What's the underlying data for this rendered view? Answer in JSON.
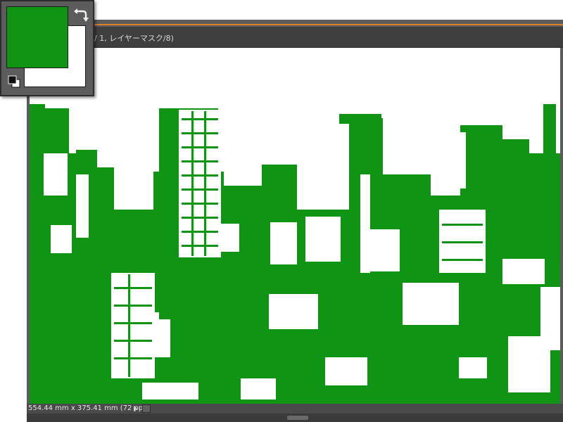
{
  "document": {
    "tab_title": "/ 1, レイヤーマスク/8)",
    "status_text": "554.44 mm x 375.41 mm (72 ppi)"
  },
  "color_picker": {
    "foreground_color": "#0f9414",
    "background_color": "#ffffff",
    "swap_icon": "swap-arrows-icon",
    "default_icon": "default-colors-icon"
  },
  "canvas": {
    "content": "green-white threshold city skyline image",
    "ink_color": "#0f9414",
    "paper_color": "#ffffff"
  }
}
